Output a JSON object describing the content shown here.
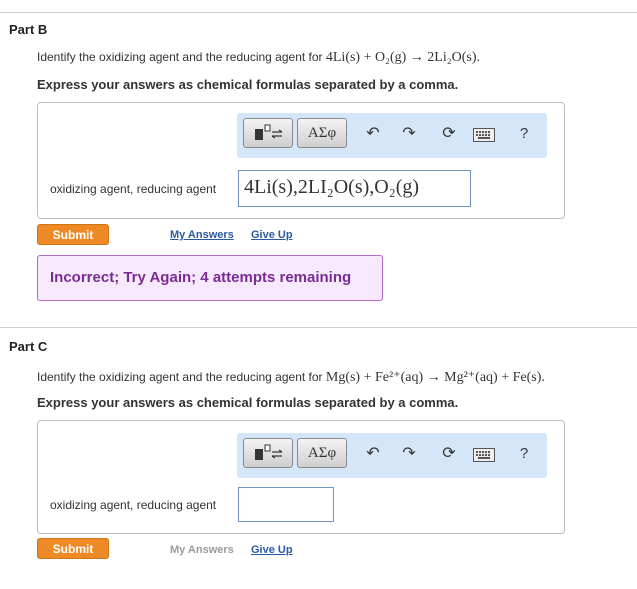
{
  "part_b": {
    "title": "Part B",
    "question_prefix": "Identify the oxidizing agent and the reducing agent for ",
    "equation": "4Li(s) + O₂(g) → 2Li₂O(s).",
    "instructions": "Express your answers as chemical formulas separated by a comma.",
    "toolbar": {
      "templates_icon": "templates-icon",
      "greek_label": "ΑΣφ",
      "undo_icon": "↶",
      "redo_icon": "↷",
      "reset_icon": "⟳",
      "keyboard_icon": "keyboard-icon",
      "help_label": "?"
    },
    "field_label": "oxidizing agent, reducing agent",
    "answer": "4Li(s),2LI₂O(s),O₂(g)",
    "submit_label": "Submit",
    "my_answers_label": "My Answers",
    "give_up_label": "Give Up",
    "feedback": "Incorrect; Try Again; 4 attempts remaining"
  },
  "part_c": {
    "title": "Part C",
    "question_prefix": "Identify the oxidizing agent and the reducing agent for ",
    "equation": "Mg(s) + Fe²⁺(aq) → Mg²⁺(aq) + Fe(s).",
    "instructions": "Express your answers as chemical formulas separated by a comma.",
    "toolbar": {
      "greek_label": "ΑΣφ",
      "help_label": "?"
    },
    "field_label": "oxidizing agent, reducing agent",
    "answer_placeholder": "",
    "submit_label": "Submit",
    "my_answers_label": "My Answers",
    "give_up_label": "Give Up"
  },
  "colors": {
    "toolbar_bg": "#d4e6f8",
    "submit_bg": "#ee8a25",
    "feedback_bg": "#f5e9fb",
    "feedback_text": "#7b2c94",
    "link": "#2a5aa0"
  }
}
